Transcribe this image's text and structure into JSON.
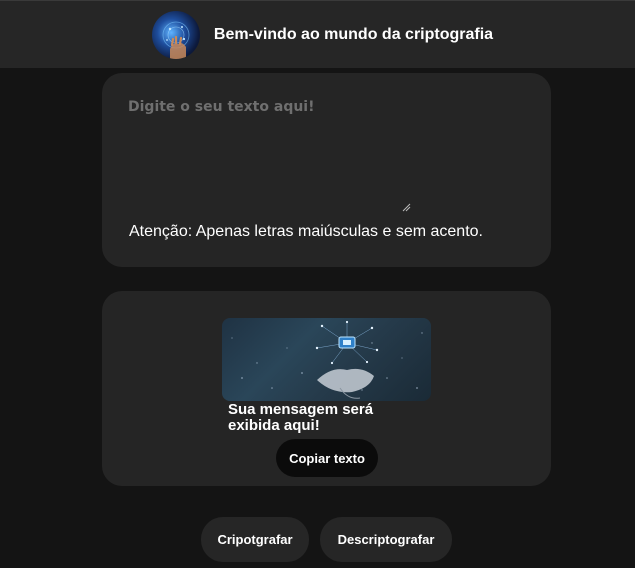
{
  "header": {
    "title": "Bem-vindo ao mundo da criptografia",
    "avatar_icon": "digital-hand-logo"
  },
  "input_card": {
    "placeholder": "Digite o seu texto aqui!",
    "warning": "Atenção: Apenas letras maiúsculas e sem acento."
  },
  "output_card": {
    "image_icon": "digital-hand-chip-image",
    "message": "Sua mensagem será exibida aqui!",
    "copy_label": "Copiar texto"
  },
  "actions": {
    "encrypt_label": "Cripotgrafar",
    "decrypt_label": "Descriptografar"
  },
  "colors": {
    "background": "#141414",
    "header": "#262626",
    "card": "#252525",
    "copy_button": "#0b0b0b",
    "text": "#ffffff",
    "placeholder": "#6f6f6f"
  }
}
